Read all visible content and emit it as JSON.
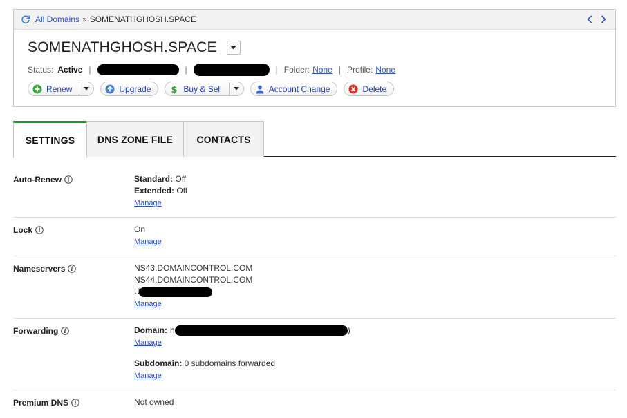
{
  "breadcrumb": {
    "root_label": "All Domains",
    "separator": "»",
    "current": "SOMENATHGHOSH.SPACE"
  },
  "domain": {
    "title": "SOMENATHGHOSH.SPACE",
    "status_label": "Status:",
    "status_value": "Active",
    "folder_label": "Folder:",
    "folder_value": "None",
    "profile_label": "Profile:",
    "profile_value": "None"
  },
  "actions": {
    "renew": "Renew",
    "upgrade": "Upgrade",
    "buy_sell": "Buy & Sell",
    "account_change": "Account Change",
    "delete": "Delete"
  },
  "tabs": [
    {
      "label": "SETTINGS",
      "active": true
    },
    {
      "label": "DNS ZONE FILE",
      "active": false
    },
    {
      "label": "CONTACTS",
      "active": false
    }
  ],
  "settings": {
    "auto_renew": {
      "label": "Auto-Renew",
      "standard_label": "Standard:",
      "standard_value": "Off",
      "extended_label": "Extended:",
      "extended_value": "Off",
      "manage": "Manage"
    },
    "lock": {
      "label": "Lock",
      "value": "On",
      "manage": "Manage"
    },
    "nameservers": {
      "label": "Nameservers",
      "ns1": "NS43.DOMAINCONTROL.COM",
      "ns2": "NS44.DOMAINCONTROL.COM",
      "ns3_prefix": "U",
      "manage": "Manage"
    },
    "forwarding": {
      "label": "Forwarding",
      "domain_label": "Domain:",
      "domain_prefix": "h",
      "domain_suffix": ")",
      "manage1": "Manage",
      "subdomain_label": "Subdomain:",
      "subdomain_value": "0 subdomains forwarded",
      "manage2": "Manage"
    },
    "premium_dns": {
      "label": "Premium DNS",
      "value": "Not owned"
    }
  },
  "colors": {
    "link": "#2b52c7",
    "active_tab_accent": "#1a9a2f",
    "delete_icon": "#d9342b",
    "renew_icon": "#3aa83a"
  }
}
